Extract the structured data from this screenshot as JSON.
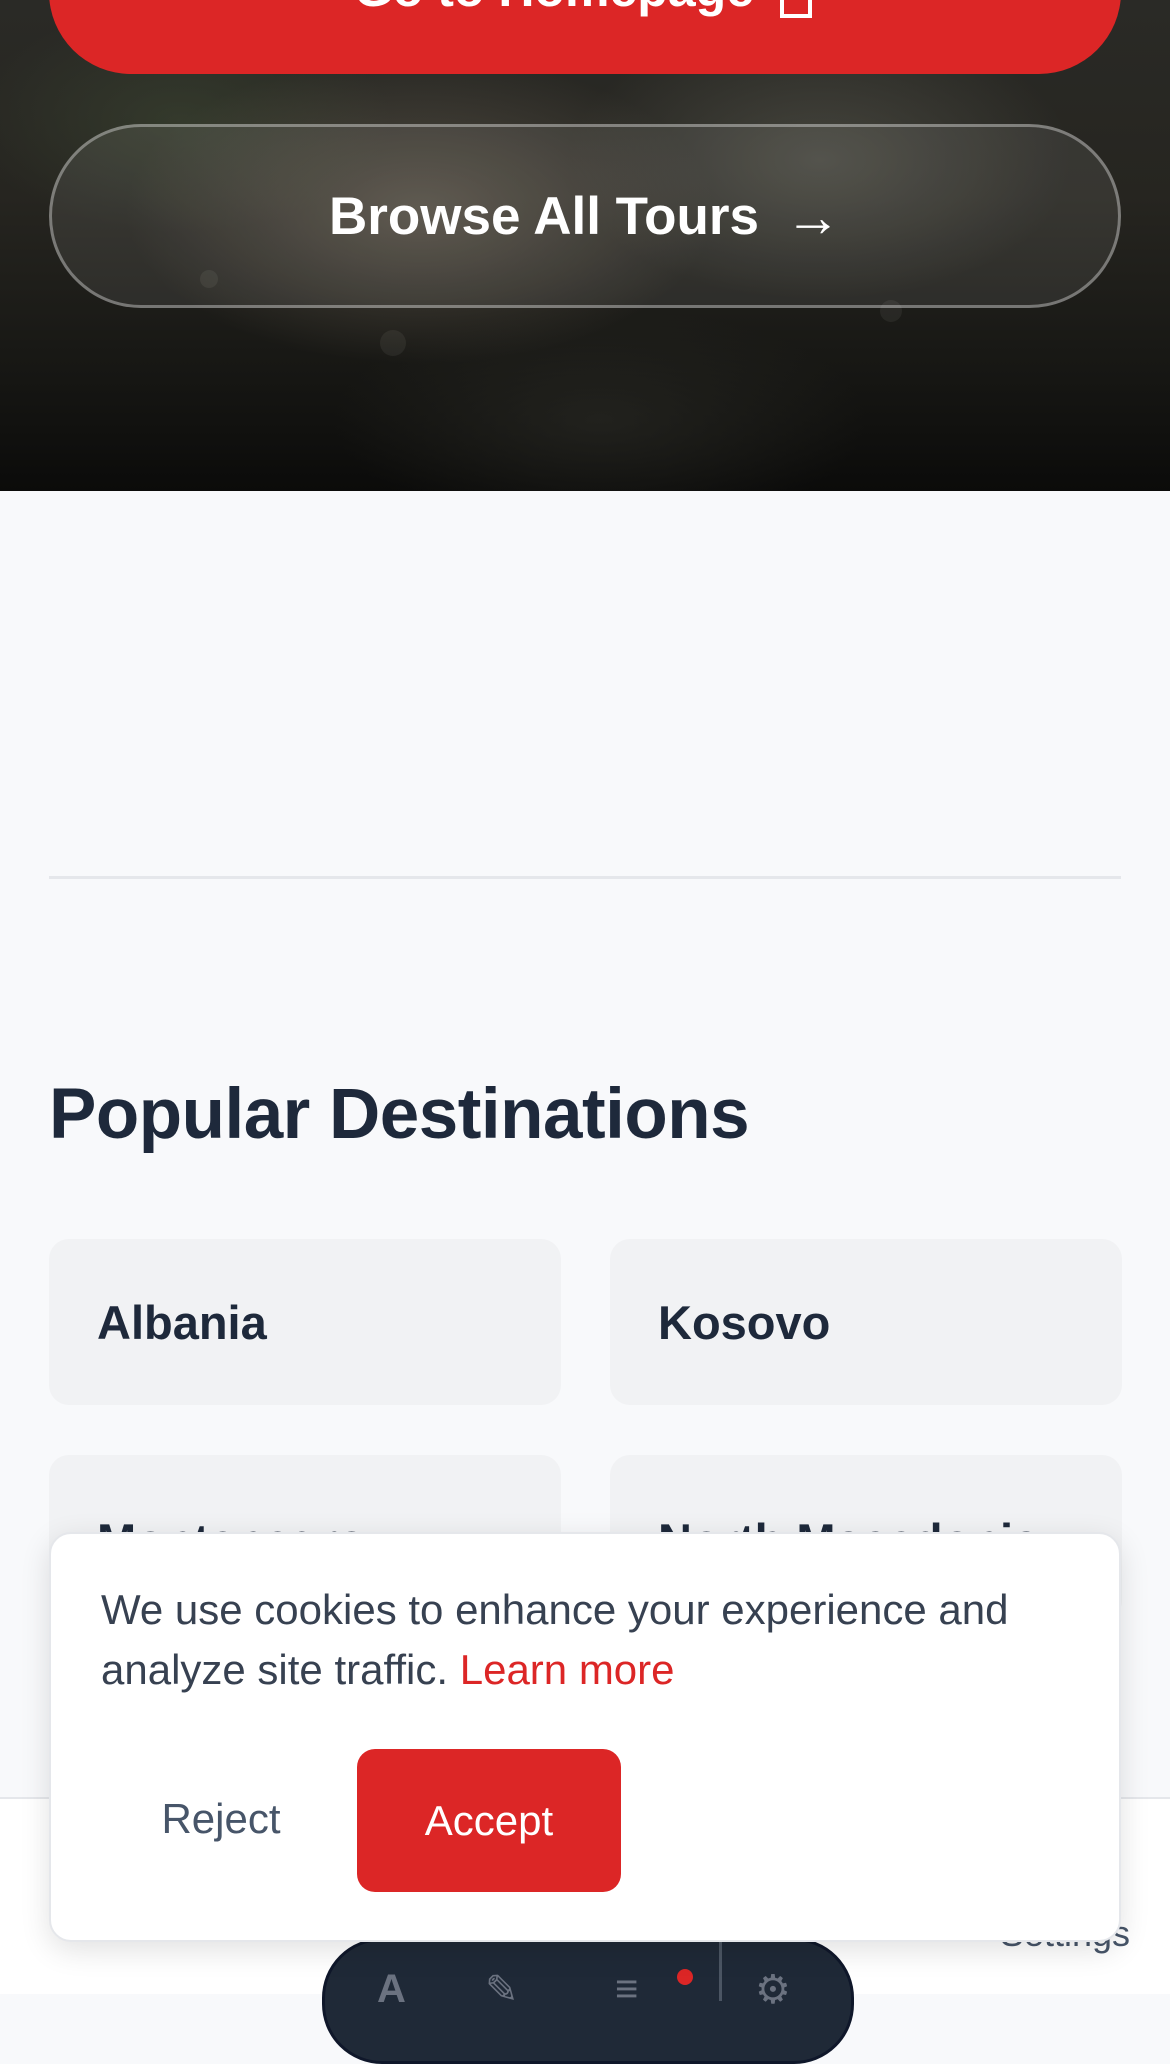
{
  "hero": {
    "home_button_label": "Go to Homepage",
    "browse_button_label": "Browse All Tours",
    "browse_arrow": "→"
  },
  "destinations": {
    "title": "Popular Destinations",
    "items": [
      {
        "label": "Albania"
      },
      {
        "label": "Kosovo"
      },
      {
        "label": "Montenegro"
      },
      {
        "label": "North Macedonia"
      }
    ]
  },
  "bottom_bar": {
    "right_label": "Settings"
  },
  "cookie_banner": {
    "message": "We use cookies to enhance your experience and analyze site traffic.",
    "link_label": "Learn more",
    "reject_label": "Reject",
    "accept_label": "Accept"
  },
  "colors": {
    "accent": "#dc2626",
    "background": "#f8f9fb",
    "card": "#f1f2f4",
    "heading": "#1e293b"
  }
}
